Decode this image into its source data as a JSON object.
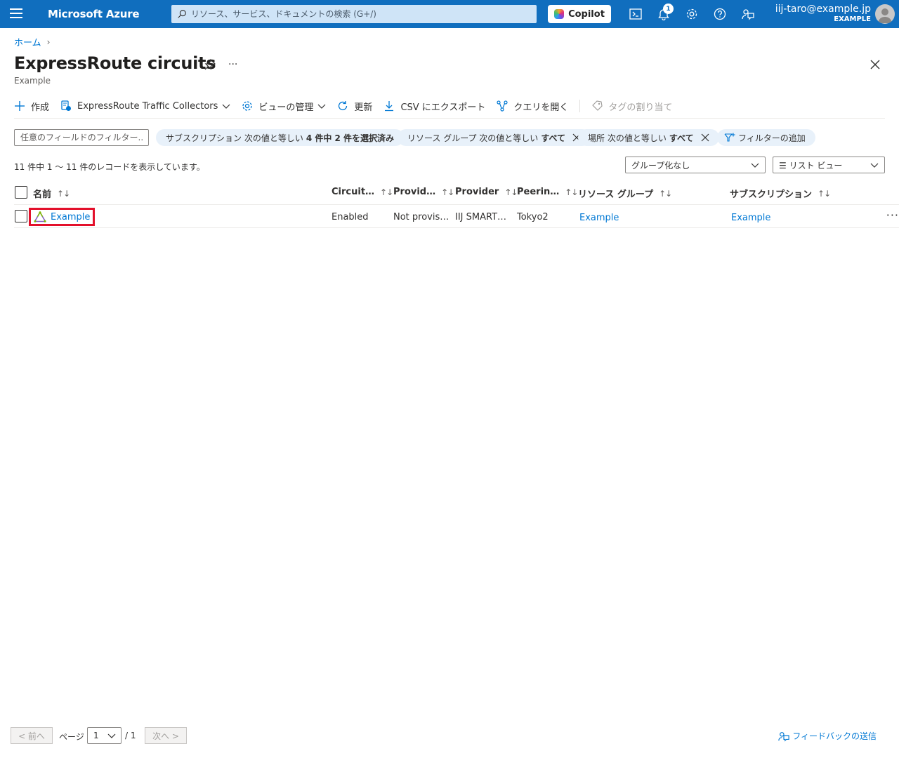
{
  "topbar": {
    "brand": "Microsoft Azure",
    "search_placeholder": "リソース、サービス、ドキュメントの検索 (G+/)",
    "copilot_label": "Copilot",
    "notification_count": "1",
    "account_email": "iij-taro@example.jp",
    "account_tenant": "EXAMPLE",
    "color": "#106ebe"
  },
  "breadcrumb": {
    "home": "ホーム",
    "separator": "›"
  },
  "page": {
    "title": "ExpressRoute circuits",
    "subtitle": "Example",
    "more": "···"
  },
  "toolbar": {
    "create": "作成",
    "traffic_collectors": "ExpressRoute Traffic Collectors",
    "manage_view": "ビューの管理",
    "refresh": "更新",
    "export_csv": "CSV にエクスポート",
    "open_query": "クエリを開く",
    "assign_tags": "タグの割り当て"
  },
  "filters": {
    "field_placeholder": "任意のフィールドのフィルター...",
    "subscription_prefix": "サブスクリプション 次の値と等しい",
    "subscription_value": "4 件中 2 件を選択済み",
    "resource_group_prefix": "リソース グループ 次の値と等しい",
    "resource_group_value": "すべて",
    "location_prefix": "場所 次の値と等しい",
    "location_value": "すべて",
    "add_filter": "フィルターの追加"
  },
  "record_count": "11 件中 1 ～ 11 件のレコードを表示しています。",
  "grouping": {
    "selected": "グループ化なし"
  },
  "view": {
    "selected": "☰ リスト ビュー"
  },
  "table": {
    "columns": [
      {
        "label": "名前"
      },
      {
        "label": "Circuit…"
      },
      {
        "label": "Provid…"
      },
      {
        "label": "Provider"
      },
      {
        "label": "Peerin…"
      },
      {
        "label": "リソース グループ"
      },
      {
        "label": "サブスクリプション"
      }
    ],
    "sort_glyph": "↑↓",
    "rows": [
      {
        "name": "Example",
        "circuit_status": "Enabled",
        "provider_status": "Not provis…",
        "provider": "IIJ SMART…",
        "peering_location": "Tokyo2",
        "resource_group": "Example",
        "subscription": "Example"
      }
    ],
    "row_more": "···"
  },
  "pager": {
    "prev": "< 前へ",
    "page_label": "ページ",
    "current_page": "1",
    "total": "/ 1",
    "next": "次へ >"
  },
  "feedback": "フィードバックの送信"
}
